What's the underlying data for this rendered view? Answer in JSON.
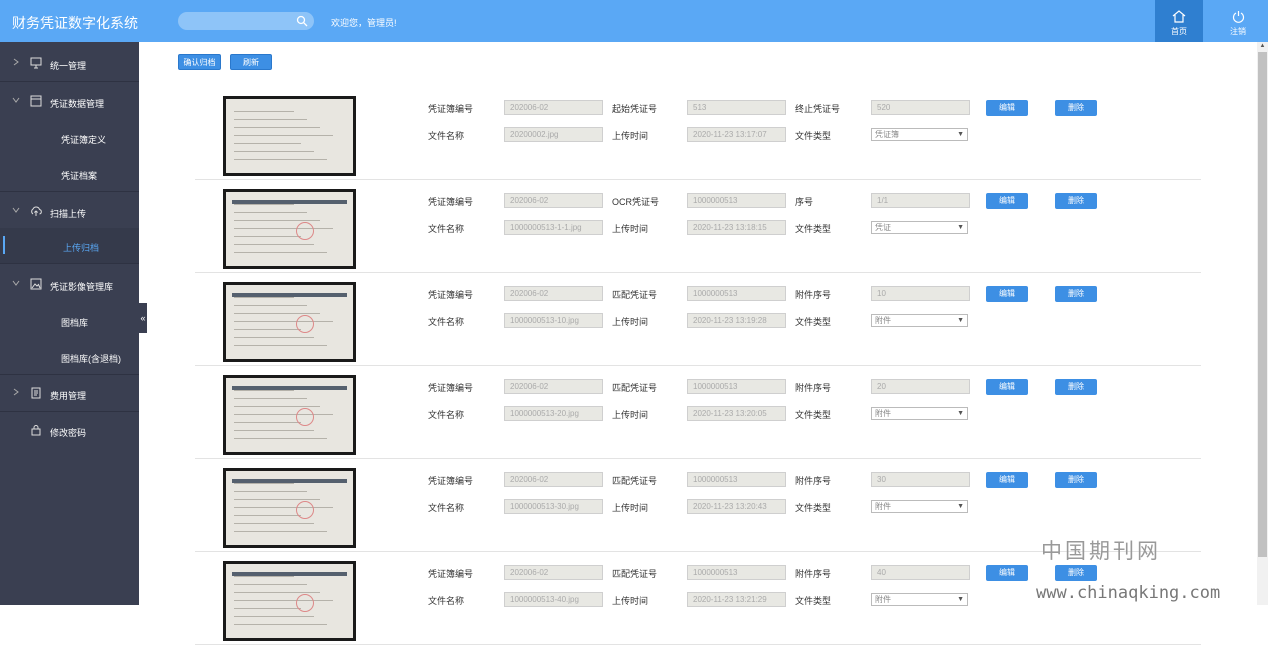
{
  "header": {
    "title": "财务凭证数字化系统",
    "search_placeholder": "",
    "welcome": "欢迎您，管理员!",
    "home_label": "首页",
    "logout_label": "注销"
  },
  "sidebar": {
    "items": [
      {
        "label": "统一管理",
        "icon": "monitor-icon"
      },
      {
        "label": "凭证数据管理",
        "icon": "window-icon"
      },
      {
        "label": "扫描上传",
        "icon": "cloud-upload-icon"
      },
      {
        "label": "凭证影像管理库",
        "icon": "image-icon"
      },
      {
        "label": "费用管理",
        "icon": "document-icon"
      },
      {
        "label": "修改密码",
        "icon": "lock-icon"
      }
    ],
    "subitems": {
      "voucher_define": "凭证簿定义",
      "voucher_archive": "凭证档案",
      "upload_archive": "上传归档",
      "image_library": "图档库",
      "image_library_returned": "图档库(含退档)"
    },
    "collapse_glyph": "«"
  },
  "toolbar": {
    "confirm_label": "确认归档",
    "refresh_label": "刷新"
  },
  "records": [
    {
      "l1": "凭证簿编号",
      "v1": "202006-02",
      "l2": "起始凭证号",
      "v2": "513",
      "l3": "终止凭证号",
      "v3": "520",
      "file_label": "文件名称",
      "file": "20200002.jpg",
      "time_label": "上传时间",
      "time": "2020-11-23 13:17:07",
      "type_label": "文件类型",
      "type": "凭证簿",
      "edit": "编辑",
      "delete": "删除"
    },
    {
      "l1": "凭证簿编号",
      "v1": "202006-02",
      "l2": "OCR凭证号",
      "v2": "1000000513",
      "l3": "序号",
      "v3": "1/1",
      "file_label": "文件名称",
      "file": "1000000513-1-1.jpg",
      "time_label": "上传时间",
      "time": "2020-11-23 13:18:15",
      "type_label": "文件类型",
      "type": "凭证",
      "edit": "编辑",
      "delete": "删除"
    },
    {
      "l1": "凭证簿编号",
      "v1": "202006-02",
      "l2": "匹配凭证号",
      "v2": "1000000513",
      "l3": "附件序号",
      "v3": "10",
      "file_label": "文件名称",
      "file": "1000000513-10.jpg",
      "time_label": "上传时间",
      "time": "2020-11-23 13:19:28",
      "type_label": "文件类型",
      "type": "附件",
      "edit": "编辑",
      "delete": "删除"
    },
    {
      "l1": "凭证簿编号",
      "v1": "202006-02",
      "l2": "匹配凭证号",
      "v2": "1000000513",
      "l3": "附件序号",
      "v3": "20",
      "file_label": "文件名称",
      "file": "1000000513-20.jpg",
      "time_label": "上传时间",
      "time": "2020-11-23 13:20:05",
      "type_label": "文件类型",
      "type": "附件",
      "edit": "编辑",
      "delete": "删除"
    },
    {
      "l1": "凭证簿编号",
      "v1": "202006-02",
      "l2": "匹配凭证号",
      "v2": "1000000513",
      "l3": "附件序号",
      "v3": "30",
      "file_label": "文件名称",
      "file": "1000000513-30.jpg",
      "time_label": "上传时间",
      "time": "2020-11-23 13:20:43",
      "type_label": "文件类型",
      "type": "附件",
      "edit": "编辑",
      "delete": "删除"
    },
    {
      "l1": "凭证簿编号",
      "v1": "202006-02",
      "l2": "匹配凭证号",
      "v2": "1000000513",
      "l3": "附件序号",
      "v3": "40",
      "file_label": "文件名称",
      "file": "1000000513-40.jpg",
      "time_label": "上传时间",
      "time": "2020-11-23 13:21:29",
      "type_label": "文件类型",
      "type": "附件",
      "edit": "编辑",
      "delete": "删除"
    }
  ],
  "watermark": {
    "cn": "中国期刊网",
    "url": "www.chinaqking.com"
  },
  "colors": {
    "header": "#5aa8f5",
    "sidebar": "#3a3f51",
    "accent": "#3d8fe4"
  }
}
